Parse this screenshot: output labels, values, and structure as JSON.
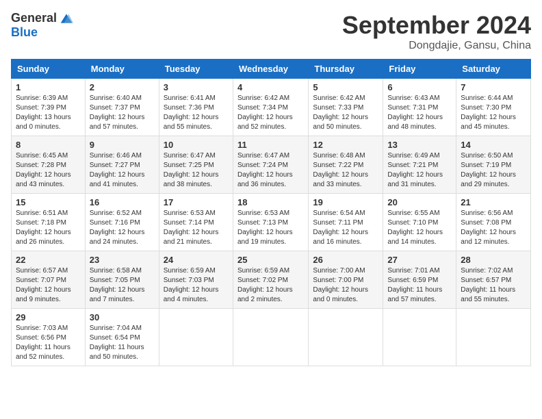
{
  "header": {
    "logo_general": "General",
    "logo_blue": "Blue",
    "title": "September 2024",
    "location": "Dongdajie, Gansu, China"
  },
  "weekdays": [
    "Sunday",
    "Monday",
    "Tuesday",
    "Wednesday",
    "Thursday",
    "Friday",
    "Saturday"
  ],
  "weeks": [
    [
      {
        "day": "1",
        "sunrise": "6:39 AM",
        "sunset": "7:39 PM",
        "daylight": "13 hours and 0 minutes."
      },
      {
        "day": "2",
        "sunrise": "6:40 AM",
        "sunset": "7:37 PM",
        "daylight": "12 hours and 57 minutes."
      },
      {
        "day": "3",
        "sunrise": "6:41 AM",
        "sunset": "7:36 PM",
        "daylight": "12 hours and 55 minutes."
      },
      {
        "day": "4",
        "sunrise": "6:42 AM",
        "sunset": "7:34 PM",
        "daylight": "12 hours and 52 minutes."
      },
      {
        "day": "5",
        "sunrise": "6:42 AM",
        "sunset": "7:33 PM",
        "daylight": "12 hours and 50 minutes."
      },
      {
        "day": "6",
        "sunrise": "6:43 AM",
        "sunset": "7:31 PM",
        "daylight": "12 hours and 48 minutes."
      },
      {
        "day": "7",
        "sunrise": "6:44 AM",
        "sunset": "7:30 PM",
        "daylight": "12 hours and 45 minutes."
      }
    ],
    [
      {
        "day": "8",
        "sunrise": "6:45 AM",
        "sunset": "7:28 PM",
        "daylight": "12 hours and 43 minutes."
      },
      {
        "day": "9",
        "sunrise": "6:46 AM",
        "sunset": "7:27 PM",
        "daylight": "12 hours and 41 minutes."
      },
      {
        "day": "10",
        "sunrise": "6:47 AM",
        "sunset": "7:25 PM",
        "daylight": "12 hours and 38 minutes."
      },
      {
        "day": "11",
        "sunrise": "6:47 AM",
        "sunset": "7:24 PM",
        "daylight": "12 hours and 36 minutes."
      },
      {
        "day": "12",
        "sunrise": "6:48 AM",
        "sunset": "7:22 PM",
        "daylight": "12 hours and 33 minutes."
      },
      {
        "day": "13",
        "sunrise": "6:49 AM",
        "sunset": "7:21 PM",
        "daylight": "12 hours and 31 minutes."
      },
      {
        "day": "14",
        "sunrise": "6:50 AM",
        "sunset": "7:19 PM",
        "daylight": "12 hours and 29 minutes."
      }
    ],
    [
      {
        "day": "15",
        "sunrise": "6:51 AM",
        "sunset": "7:18 PM",
        "daylight": "12 hours and 26 minutes."
      },
      {
        "day": "16",
        "sunrise": "6:52 AM",
        "sunset": "7:16 PM",
        "daylight": "12 hours and 24 minutes."
      },
      {
        "day": "17",
        "sunrise": "6:53 AM",
        "sunset": "7:14 PM",
        "daylight": "12 hours and 21 minutes."
      },
      {
        "day": "18",
        "sunrise": "6:53 AM",
        "sunset": "7:13 PM",
        "daylight": "12 hours and 19 minutes."
      },
      {
        "day": "19",
        "sunrise": "6:54 AM",
        "sunset": "7:11 PM",
        "daylight": "12 hours and 16 minutes."
      },
      {
        "day": "20",
        "sunrise": "6:55 AM",
        "sunset": "7:10 PM",
        "daylight": "12 hours and 14 minutes."
      },
      {
        "day": "21",
        "sunrise": "6:56 AM",
        "sunset": "7:08 PM",
        "daylight": "12 hours and 12 minutes."
      }
    ],
    [
      {
        "day": "22",
        "sunrise": "6:57 AM",
        "sunset": "7:07 PM",
        "daylight": "12 hours and 9 minutes."
      },
      {
        "day": "23",
        "sunrise": "6:58 AM",
        "sunset": "7:05 PM",
        "daylight": "12 hours and 7 minutes."
      },
      {
        "day": "24",
        "sunrise": "6:59 AM",
        "sunset": "7:03 PM",
        "daylight": "12 hours and 4 minutes."
      },
      {
        "day": "25",
        "sunrise": "6:59 AM",
        "sunset": "7:02 PM",
        "daylight": "12 hours and 2 minutes."
      },
      {
        "day": "26",
        "sunrise": "7:00 AM",
        "sunset": "7:00 PM",
        "daylight": "12 hours and 0 minutes."
      },
      {
        "day": "27",
        "sunrise": "7:01 AM",
        "sunset": "6:59 PM",
        "daylight": "11 hours and 57 minutes."
      },
      {
        "day": "28",
        "sunrise": "7:02 AM",
        "sunset": "6:57 PM",
        "daylight": "11 hours and 55 minutes."
      }
    ],
    [
      {
        "day": "29",
        "sunrise": "7:03 AM",
        "sunset": "6:56 PM",
        "daylight": "11 hours and 52 minutes."
      },
      {
        "day": "30",
        "sunrise": "7:04 AM",
        "sunset": "6:54 PM",
        "daylight": "11 hours and 50 minutes."
      },
      null,
      null,
      null,
      null,
      null
    ]
  ],
  "labels": {
    "sunrise_prefix": "Sunrise: ",
    "sunset_prefix": "Sunset: ",
    "daylight_prefix": "Daylight: "
  }
}
